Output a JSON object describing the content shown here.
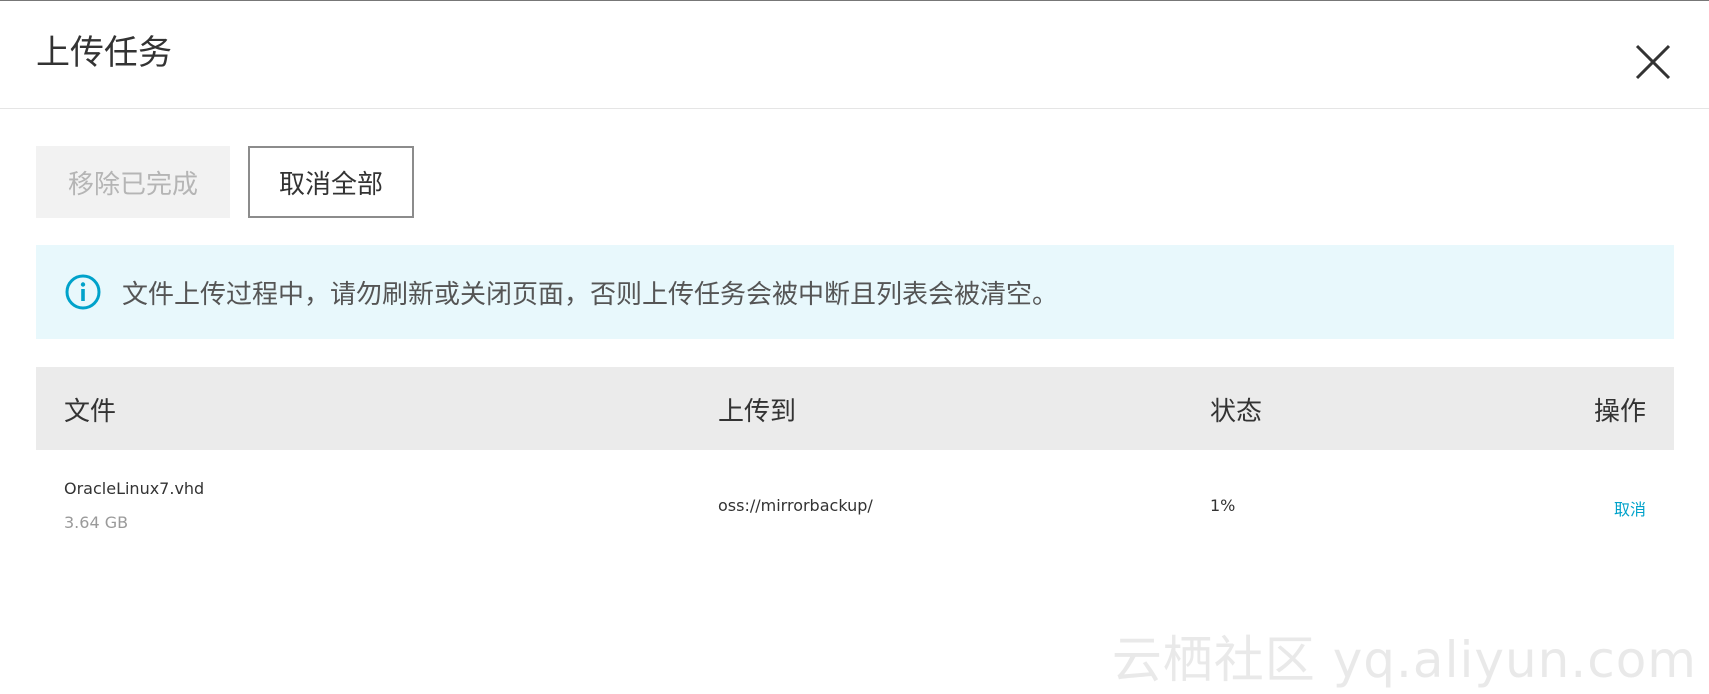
{
  "dialog": {
    "title": "上传任务",
    "close_icon": "close-icon"
  },
  "toolbar": {
    "remove_completed_label": "移除已完成",
    "cancel_all_label": "取消全部"
  },
  "notice": {
    "icon": "info-icon",
    "text": "文件上传过程中，请勿刷新或关闭页面，否则上传任务会被中断且列表会被清空。",
    "accent_color": "#00a2ca",
    "background_color": "#e8f8fc"
  },
  "table": {
    "headers": {
      "file": "文件",
      "destination": "上传到",
      "status": "状态",
      "action": "操作"
    },
    "rows": [
      {
        "file_name": "OracleLinux7.vhd",
        "file_size": "3.64 GB",
        "destination": "oss://mirrorbackup/",
        "status": "1%",
        "action": "取消"
      }
    ]
  },
  "watermark": "云栖社区 yq.aliyun.com"
}
